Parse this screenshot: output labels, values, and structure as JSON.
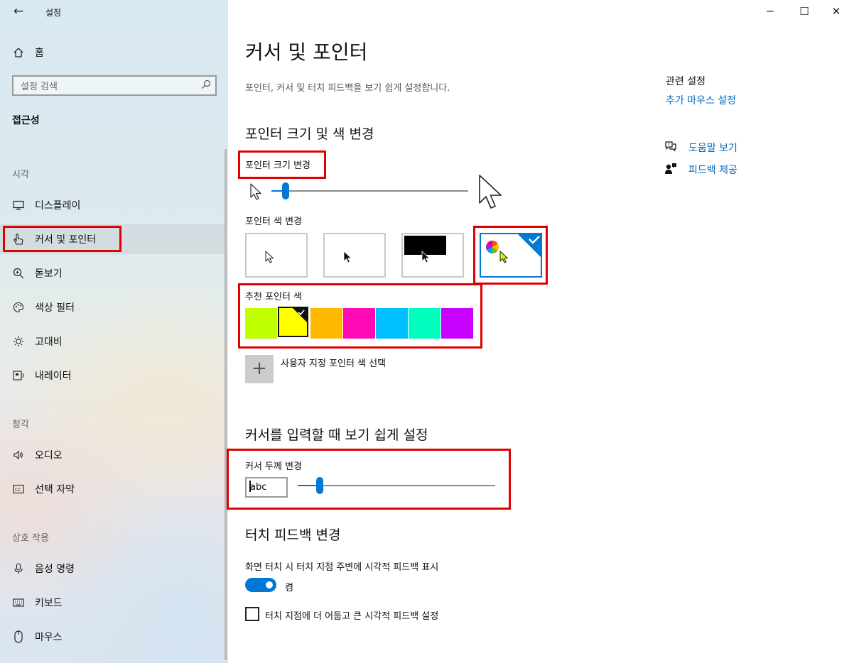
{
  "window": {
    "title": "설정",
    "controls": {
      "minimize": "─",
      "maximize": "☐",
      "close": "✕"
    }
  },
  "sidebar": {
    "back": "←",
    "home": "홈",
    "search_placeholder": "설정 검색",
    "category": "접근성",
    "sections": [
      {
        "heading": "시각",
        "items": [
          {
            "label": "디스플레이",
            "icon": "monitor-icon"
          },
          {
            "label": "커서 및 포인터",
            "icon": "pointer-hand-icon",
            "active": true
          },
          {
            "label": "돋보기",
            "icon": "magnifier-icon"
          },
          {
            "label": "색상 필터",
            "icon": "palette-icon"
          },
          {
            "label": "고대비",
            "icon": "sun-icon"
          },
          {
            "label": "내레이터",
            "icon": "narrator-icon"
          }
        ]
      },
      {
        "heading": "청각",
        "items": [
          {
            "label": "오디오",
            "icon": "speaker-icon"
          },
          {
            "label": "선택 자막",
            "icon": "captions-icon"
          }
        ]
      },
      {
        "heading": "상호 작용",
        "items": [
          {
            "label": "음성 명령",
            "icon": "microphone-icon"
          },
          {
            "label": "키보드",
            "icon": "keyboard-icon"
          },
          {
            "label": "마우스",
            "icon": "mouse-icon"
          }
        ]
      }
    ]
  },
  "main": {
    "title": "커서 및 포인터",
    "description": "포인터, 커서 및 터치 피드백을 보기 쉽게 설정합니다.",
    "pointer_section": {
      "heading": "포인터 크기 및 색 변경",
      "size_label": "포인터 크기 변경",
      "size_value": 0.1,
      "color_label": "포인터 색 변경",
      "color_options": [
        "white",
        "black",
        "inverted",
        "custom"
      ],
      "selected_color_option": "custom",
      "recommended_label": "추천 포인터 색",
      "recommended_colors": [
        "#bfff00",
        "#ffff00",
        "#ffb900",
        "#ff0ab4",
        "#00bfff",
        "#00ffbe",
        "#c800ff"
      ],
      "selected_recommended_index": 1,
      "custom_color_label": "사용자 지정 포인터 색 선택",
      "custom_color_button": "+"
    },
    "cursor_section": {
      "heading": "커서를 입력할 때 보기 쉽게 설정",
      "thickness_label": "커서 두께 변경",
      "preview_text": "abc",
      "thickness_value": 0.12
    },
    "touch_section": {
      "heading": "터치 피드백 변경",
      "show_label": "화면 터치 시 터치 지점 주변에 시각적 피드백 표시",
      "toggle_state": "켬",
      "darker_label": "터치 지점에 더 어둡고 큰 시각적 피드백 설정"
    }
  },
  "related": {
    "title": "관련 설정",
    "mouse_link": "추가 마우스 설정",
    "help": "도움말 보기",
    "feedback": "피드백 제공"
  },
  "colors": {
    "accent": "#0078d4",
    "highlight": "#e00000",
    "link": "#0067c0"
  }
}
